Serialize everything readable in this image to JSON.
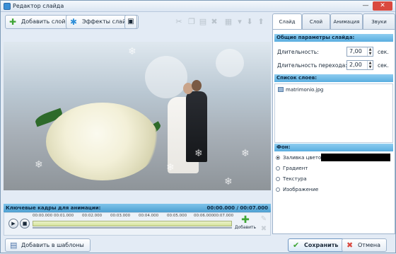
{
  "window": {
    "title": "Редактор слайда",
    "min": "—",
    "close": "✕"
  },
  "toolbar": {
    "add_layer": "Добавить слой",
    "effects": "Эффекты слайда"
  },
  "tabs": [
    {
      "label": "Слайд",
      "active": true
    },
    {
      "label": "Слой",
      "active": false
    },
    {
      "label": "Анимация",
      "active": false
    },
    {
      "label": "Звуки",
      "active": false
    }
  ],
  "slide_params": {
    "header": "Общие параметры слайда:",
    "duration_label": "Длительность:",
    "duration_value": "7,00",
    "transition_label": "Длительность перехода:",
    "transition_value": "2,00",
    "unit": "сек."
  },
  "layers": {
    "header": "Список слоев:",
    "items": [
      "matrimonio.jpg"
    ]
  },
  "background": {
    "header": "Фон:",
    "options": [
      {
        "label": "Заливка цветом",
        "selected": true
      },
      {
        "label": "Градиент",
        "selected": false
      },
      {
        "label": "Текстура",
        "selected": false
      },
      {
        "label": "Изображение",
        "selected": false
      }
    ],
    "fill_color": "#000000"
  },
  "timeline": {
    "label": "Ключевые кадры для анимации:",
    "time": "00:00.000 / 00:07.000",
    "ticks": [
      "00:00.000",
      "00:01.000",
      "00:02.000",
      "00:03.000",
      "00:04.000",
      "00:05.000",
      "00:06.000",
      "00:07.000"
    ],
    "add_label": "Добавить"
  },
  "bottom": {
    "add_template": "Добавить в шаблоны",
    "save": "Сохранить",
    "cancel": "Отмена"
  }
}
